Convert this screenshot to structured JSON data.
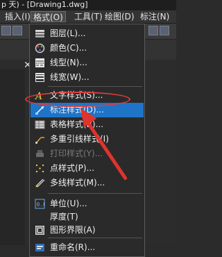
{
  "window": {
    "title": "p 天) - [Drawing1.dwg]"
  },
  "menubar": {
    "items": [
      {
        "label": "插入(I)"
      },
      {
        "label": "格式(O)"
      },
      {
        "label": "工具(T)"
      },
      {
        "label": "绘图(D)"
      },
      {
        "label": "标注(N)"
      }
    ]
  },
  "menu": {
    "groups": [
      [
        {
          "label": "图层(L)...",
          "icon": "layers-icon"
        },
        {
          "label": "颜色(C)...",
          "icon": "color-palette-icon"
        },
        {
          "label": "线型(N)...",
          "icon": "linetype-icon"
        },
        {
          "label": "线宽(W)...",
          "icon": "lineweight-icon"
        }
      ],
      [
        {
          "label": "文字样式(S)...",
          "icon": "text-style-icon"
        },
        {
          "label": "标注样式(D)...",
          "icon": "dimension-style-icon",
          "highlighted": true
        },
        {
          "label": "表格样式(B)...",
          "icon": "table-style-icon"
        },
        {
          "label": "多重引线样式(I)",
          "icon": "multileader-style-icon"
        },
        {
          "label": "打印样式(Y)...",
          "icon": "plot-style-icon",
          "disabled": true
        },
        {
          "label": "点样式(P)...",
          "icon": "point-style-icon"
        },
        {
          "label": "多线样式(M)...",
          "icon": "multiline-style-icon"
        }
      ],
      [
        {
          "label": "单位(U)...",
          "icon": "units-icon"
        },
        {
          "label": "厚度(T)",
          "icon": ""
        },
        {
          "label": "图形界限(A)",
          "icon": "drawing-limits-icon"
        }
      ],
      [
        {
          "label": "重命名(R)...",
          "icon": "rename-icon"
        }
      ]
    ]
  },
  "annotation": {
    "color": "#e0332c"
  },
  "colors": {
    "highlight": "#1f74c8",
    "menu_bg": "#2a2a2a"
  }
}
